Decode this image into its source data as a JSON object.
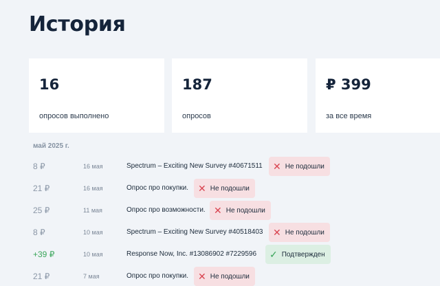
{
  "page": {
    "title": "История"
  },
  "stats": [
    {
      "value": "16",
      "label": "опросов выполнено"
    },
    {
      "value": "187",
      "label": "опросов"
    },
    {
      "value": "₽ 399",
      "label": "за все время"
    }
  ],
  "history": {
    "month": "май 2025 г.",
    "rows": [
      {
        "amount": "8 ₽",
        "date": "16 мая",
        "title": "Spectrum – Exciting New Survey #40671511",
        "status": "Не подошли",
        "status_type": "rejected"
      },
      {
        "amount": "21 ₽",
        "date": "16 мая",
        "title": "Опрос про покупки.",
        "status": "Не подошли",
        "status_type": "rejected"
      },
      {
        "amount": "25 ₽",
        "date": "11 мая",
        "title": "Опрос про возможности.",
        "status": "Не подошли",
        "status_type": "rejected"
      },
      {
        "amount": "8 ₽",
        "date": "10 мая",
        "title": "Spectrum – Exciting New Survey #40518403",
        "status": "Не подошли",
        "status_type": "rejected"
      },
      {
        "amount": "+39 ₽",
        "date": "10 мая",
        "title": "Response Now, Inc. #13086902 #7229596",
        "status": "Подтвержден",
        "status_type": "confirmed"
      },
      {
        "amount": "21 ₽",
        "date": "7 мая",
        "title": "Опрос про покупки.",
        "status": "Не подошли",
        "status_type": "rejected"
      }
    ]
  },
  "icons": {
    "rejected": "close-x-icon",
    "confirmed": "check-icon"
  },
  "colors": {
    "rejected_bg": "#f7dfe2",
    "rejected_icon": "#d9434f",
    "confirmed_bg": "#dcefe3",
    "confirmed_icon": "#3aa55a"
  }
}
